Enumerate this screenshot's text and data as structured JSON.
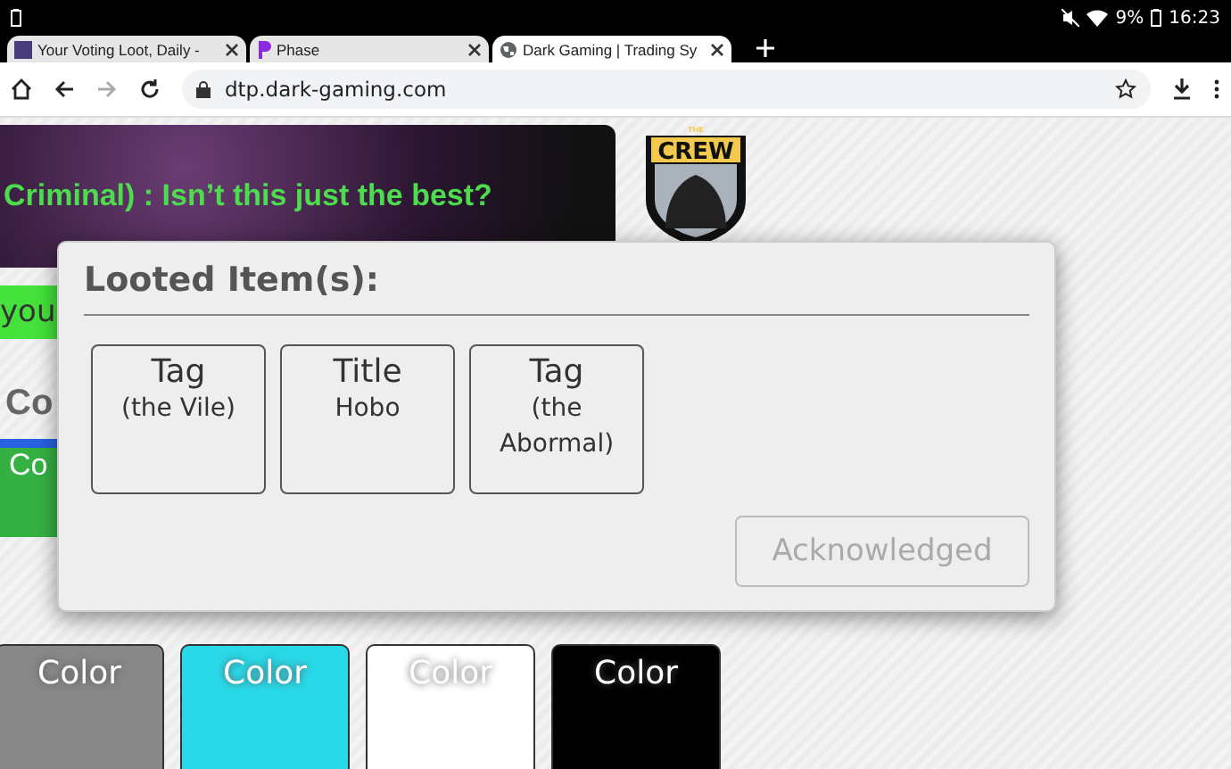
{
  "status_bar": {
    "battery": "9%",
    "time": "16:23"
  },
  "tabs": [
    {
      "title": "Your Voting Loot, Daily -",
      "selected": false,
      "kind": "square"
    },
    {
      "title": "Phase",
      "selected": false,
      "kind": "letter"
    },
    {
      "title": "Dark Gaming | Trading Sy",
      "selected": true,
      "kind": "globe"
    }
  ],
  "address_bar": {
    "url": "dtp.dark-gaming.com"
  },
  "banner": {
    "text": "Criminal) : Isn’t this just the best?"
  },
  "logo": {
    "top_text": "THE",
    "text": "CREW"
  },
  "green_strip": {
    "text": "you"
  },
  "section_heading": "Co",
  "green_card": {
    "text": "Co"
  },
  "color_cards": [
    {
      "label": "Color",
      "color": "#888888"
    },
    {
      "label": "Color",
      "color": "#29d9e8"
    },
    {
      "label": "Color",
      "color": "#ffffff"
    },
    {
      "label": "Color",
      "color": "#000000"
    }
  ],
  "dialog": {
    "title": "Looted Item(s):",
    "items": [
      {
        "type": "Tag",
        "name": "(the Vile)"
      },
      {
        "type": "Title",
        "name": "Hobo"
      },
      {
        "type": "Tag",
        "name": "(the Abormal)"
      }
    ],
    "button": {
      "label": "Acknowledged",
      "disabled": true
    }
  }
}
